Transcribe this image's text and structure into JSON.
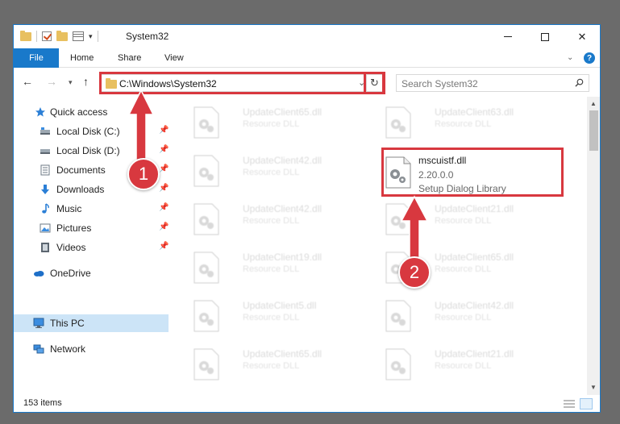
{
  "window": {
    "title": "System32"
  },
  "ribbon": {
    "tabs": [
      {
        "label": "File"
      },
      {
        "label": "Home"
      },
      {
        "label": "Share"
      },
      {
        "label": "View"
      }
    ]
  },
  "nav": {
    "address": "C:\\Windows\\System32",
    "search_placeholder": "Search System32"
  },
  "sidebar": {
    "items": [
      {
        "label": "Quick access",
        "icon": "star-icon",
        "pinned": false
      },
      {
        "label": "Local Disk (C:)",
        "icon": "drive-icon",
        "pinned": true
      },
      {
        "label": "Local Disk (D:)",
        "icon": "drive-icon",
        "pinned": true
      },
      {
        "label": "Documents",
        "icon": "documents-icon",
        "pinned": true
      },
      {
        "label": "Downloads",
        "icon": "downloads-icon",
        "pinned": true
      },
      {
        "label": "Music",
        "icon": "music-icon",
        "pinned": true
      },
      {
        "label": "Pictures",
        "icon": "pictures-icon",
        "pinned": true
      },
      {
        "label": "Videos",
        "icon": "videos-icon",
        "pinned": true
      },
      {
        "label": "OneDrive",
        "icon": "onedrive-icon",
        "pinned": false
      },
      {
        "label": "This PC",
        "icon": "pc-icon",
        "pinned": false,
        "selected": true
      },
      {
        "label": "Network",
        "icon": "network-icon",
        "pinned": false
      }
    ]
  },
  "files": {
    "left": [
      {
        "name": "UpdateClient65.dll",
        "desc": "Resource DLL"
      },
      {
        "name": "UpdateClient42.dll",
        "desc": "Resource DLL"
      },
      {
        "name": "UpdateClient42.dll",
        "desc": "Resource DLL"
      },
      {
        "name": "UpdateClient19.dll",
        "desc": "Resource DLL"
      },
      {
        "name": "UpdateClient5.dll",
        "desc": "Resource DLL"
      },
      {
        "name": "UpdateClient65.dll",
        "desc": "Resource DLL"
      }
    ],
    "right": [
      {
        "name": "UpdateClient63.dll",
        "desc": "Resource DLL"
      },
      {
        "name": "UpdateClient21.dll",
        "desc": "Resource DLL"
      },
      {
        "name": "UpdateClient65.dll",
        "desc": "Resource DLL"
      },
      {
        "name": "UpdateClient42.dll",
        "desc": "Resource DLL"
      },
      {
        "name": "UpdateClient21.dll",
        "desc": "Resource DLL"
      }
    ],
    "target": {
      "name": "mscuistf.dll",
      "version": "2.20.0.0",
      "desc": "Setup Dialog Library"
    }
  },
  "status": {
    "item_count": "153 items"
  },
  "annotations": {
    "step1": "1",
    "step2": "2",
    "color": "#d8383f"
  },
  "colors": {
    "accent": "#1979ca",
    "selected": "#cce4f7"
  }
}
